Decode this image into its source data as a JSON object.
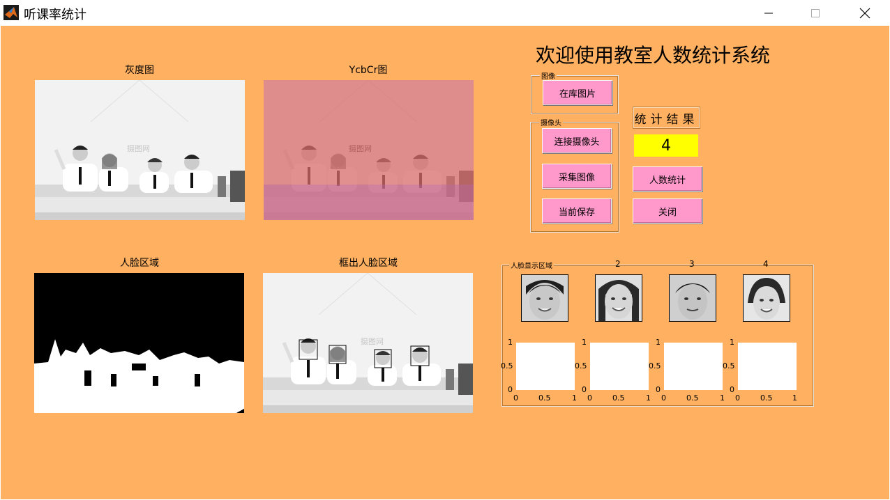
{
  "window": {
    "title": "听课率统计",
    "minimize_icon": "minimize-icon",
    "maximize_icon": "maximize-icon",
    "close_icon": "close-icon"
  },
  "panels": {
    "gray_title": "灰度图",
    "ycbcr_title": "YcbCr图",
    "face_region_title": "人脸区域",
    "boxed_faces_title": "框出人脸区域",
    "watermark": "摄图网"
  },
  "heading": "欢迎使用教室人数统计系统",
  "image_group": {
    "title": "图像",
    "library_button": "在库图片"
  },
  "camera_group": {
    "title": "摄像头",
    "connect_button": "连接摄像头",
    "capture_button": "采集图像",
    "save_button": "当前保存"
  },
  "result": {
    "label": "统计结果",
    "count": "4",
    "count_button": "人数统计",
    "close_button": "关闭"
  },
  "face_display": {
    "title": "人脸显示区域",
    "numbers": [
      "2",
      "3",
      "4"
    ],
    "axis_ticks": {
      "y_top": "1",
      "y_mid": "0.5",
      "y_bottom": "0",
      "x_left": "0",
      "x_mid": "0.5",
      "x_right": "1"
    }
  },
  "colors": {
    "background": "#ffb061",
    "button": "#ff99cc",
    "count_box": "#ffff00",
    "ycbcr_tint": "#e08080"
  }
}
